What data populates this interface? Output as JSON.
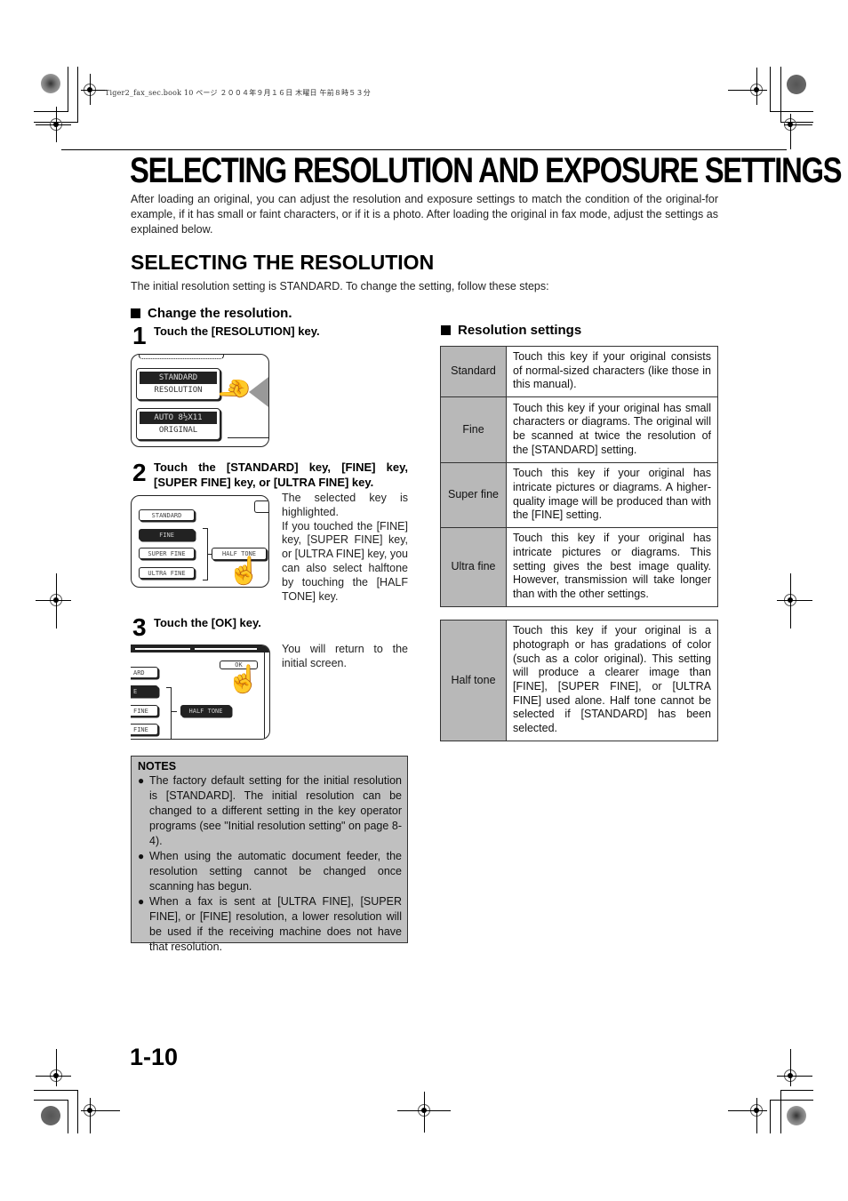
{
  "print_header": {
    "meta_text": "Tiger2_fax_sec.book  10 ページ  ２００４年９月１６日  木曜日  午前８時５３分"
  },
  "page": {
    "title": "SELECTING RESOLUTION AND EXPOSURE SETTINGS",
    "intro": "After loading an original, you can adjust the resolution and exposure settings to match the condition of the original-for example, if it has small or faint characters, or if it is a photo. After loading the original in fax mode, adjust the settings as explained below.",
    "page_number": "1-10"
  },
  "section": {
    "title": "SELECTING THE RESOLUTION",
    "intro": "The initial resolution setting is STANDARD. To change the setting, follow these steps:"
  },
  "procedure": {
    "heading": "Change the resolution.",
    "steps": [
      {
        "number": "1",
        "instruction": "Touch the [RESOLUTION] key.",
        "description": "",
        "screen": {
          "resolution_value": "STANDARD",
          "resolution_label": "RESOLUTION",
          "original_value": "AUTO   8½X11",
          "original_label": "ORIGINAL"
        }
      },
      {
        "number": "2",
        "instruction": "Touch the [STANDARD] key, [FINE] key, [SUPER FINE] key, or [ULTRA FINE] key.",
        "description": "The selected key is highlighted. If you touched the [FINE] key, [SUPER FINE] key, or [ULTRA FINE] key, you can also select halftone by touching the [HALF TONE] key.",
        "description_line1": "The selected key is highlighted.",
        "description_line2": "If you touched the [FINE] key, [SUPER FINE] key, or [ULTRA FINE] key, you can also select halftone by touching the [HALF TONE] key.",
        "screen": {
          "keys": [
            "STANDARD",
            "FINE",
            "SUPER FINE",
            "ULTRA FINE"
          ],
          "selected_key": "FINE",
          "halftone_key": "HALF TONE"
        }
      },
      {
        "number": "3",
        "instruction": "Touch the [OK] key.",
        "description": "You will return to the initial screen.",
        "screen": {
          "keys_partial": [
            "ARD",
            "E",
            "FINE",
            "FINE"
          ],
          "halftone_key": "HALF TONE",
          "ok_key": "OK"
        }
      }
    ]
  },
  "notes": {
    "title": "NOTES",
    "items": [
      "The factory default setting for the initial resolution is [STANDARD]. The initial resolution can be changed to a different setting in the key operator programs (see \"Initial resolution setting\" on page 8-4).",
      "When using the automatic document feeder, the resolution setting cannot be changed once scanning has begun.",
      "When a fax is sent at [ULTRA FINE], [SUPER FINE], or [FINE] resolution, a lower resolution will be used if the receiving machine does not have that resolution."
    ],
    "bullet": "●"
  },
  "resolution_settings": {
    "heading": "Resolution settings",
    "rows": [
      {
        "label": "Standard",
        "description": "Touch this key if your original consists of normal-sized characters (like those in this manual)."
      },
      {
        "label": "Fine",
        "description": "Touch this key if your original has small characters or diagrams. The original will be scanned at twice the resolution of the [STANDARD] setting."
      },
      {
        "label": "Super fine",
        "description": "Touch this key if your original has intricate pictures or diagrams. A higher-quality image will be produced than with the [FINE] setting."
      },
      {
        "label": "Ultra fine",
        "description": "Touch this key if your original has intricate pictures or diagrams. This setting gives the best image quality. However, transmission will take longer than with the other settings."
      }
    ],
    "halftone": {
      "label": "Half tone",
      "description": "Touch this key if your original is a photograph or has gradations of color (such as a color original). This setting will produce a clearer image than [FINE], [SUPER FINE], or [ULTRA FINE] used alone. Half tone cannot be selected if [STANDARD] has been selected."
    }
  },
  "icons": {
    "hand": "☝"
  }
}
